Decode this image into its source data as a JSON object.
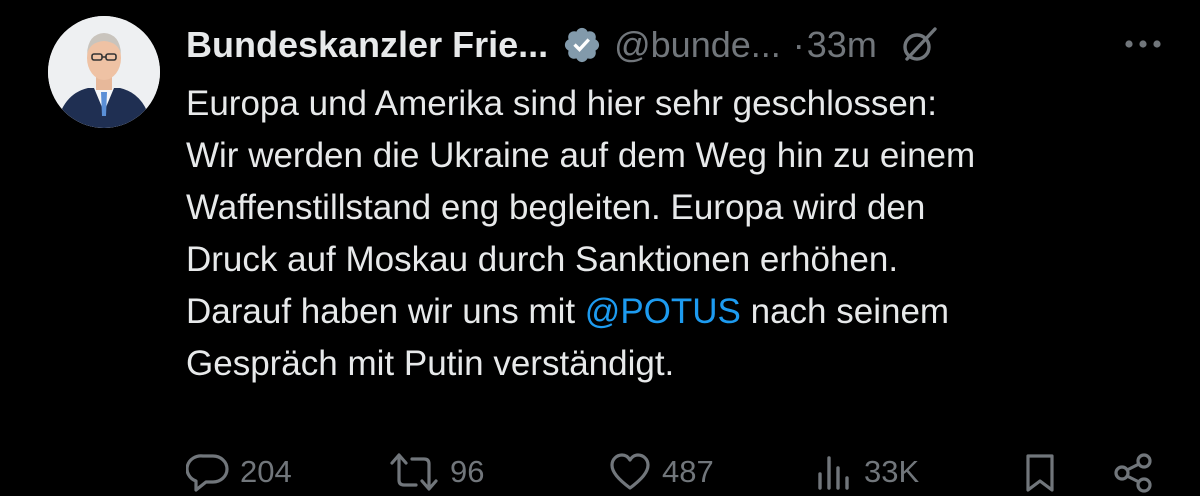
{
  "tweet": {
    "author_name": "Bundeskanzler Frie...",
    "handle": "@bunde...",
    "separator": "·",
    "timestamp": "33m",
    "text_lines": [
      {
        "before": "Europa und Amerika sind hier sehr geschlossen:",
        "mention": "",
        "after": ""
      },
      {
        "before": "Wir werden die Ukraine auf dem Weg hin zu einem",
        "mention": "",
        "after": ""
      },
      {
        "before": "Waffenstillstand eng begleiten. Europa wird den",
        "mention": "",
        "after": ""
      },
      {
        "before": "Druck auf Moskau durch Sanktionen erhöhen.",
        "mention": "",
        "after": ""
      },
      {
        "before": "Darauf haben wir uns mit ",
        "mention": "@POTUS",
        "after": " nach seinem"
      },
      {
        "before": "Gespräch mit Putin verständigt.",
        "mention": "",
        "after": ""
      }
    ],
    "metrics": {
      "replies": "204",
      "reposts": "96",
      "likes": "487",
      "views": "33K"
    }
  },
  "icons": {
    "verified": "verified-badge-icon",
    "grok": "grok-icon",
    "more": "more-icon",
    "reply": "reply-icon",
    "repost": "repost-icon",
    "like": "heart-icon",
    "views": "views-icon",
    "bookmark": "bookmark-icon",
    "share": "share-icon"
  },
  "colors": {
    "background": "#000000",
    "text": "#e7e9ea",
    "secondary": "#71767b",
    "mention": "#1d9bf0"
  }
}
